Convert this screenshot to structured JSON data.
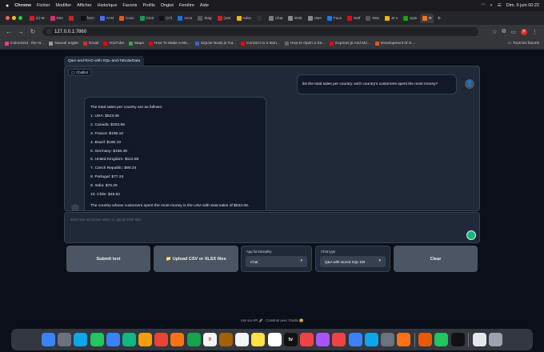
{
  "menubar": {
    "apple": "",
    "app": "Chrome",
    "items": [
      "Fichier",
      "Modifier",
      "Afficher",
      "Historique",
      "Favoris",
      "Profils",
      "Onglet",
      "Fenêtre",
      "Aide"
    ],
    "datetime": "Dim. 9 juin  00:22"
  },
  "tabs": [
    {
      "label": "(1) M",
      "color": "#cc2222"
    },
    {
      "label": "Dire",
      "color": "#d6336c"
    },
    {
      "label": "",
      "color": "#cc2222"
    },
    {
      "label": "form",
      "color": "#111111"
    },
    {
      "label": "AI M",
      "color": "#4a6cf7"
    },
    {
      "label": "Conv",
      "color": "#e8590c"
    },
    {
      "label": "2110",
      "color": "#0f9d58"
    },
    {
      "label": "(17)",
      "color": "#111111"
    },
    {
      "label": "Acce",
      "color": "#1a73e8"
    },
    {
      "label": "Stag",
      "color": "#555555"
    },
    {
      "label": "(104",
      "color": "#cc2222"
    },
    {
      "label": "Adva",
      "color": "#f4b400"
    },
    {
      "label": "",
      "color": "#333333"
    },
    {
      "label": "Chat",
      "color": "#7b7b7b"
    },
    {
      "label": "Emb",
      "color": "#888888"
    },
    {
      "label": "User",
      "color": "#888888"
    },
    {
      "label": "Face",
      "color": "#1877f2"
    },
    {
      "label": "Netf",
      "color": "#e50914"
    },
    {
      "label": "Mas",
      "color": "#555555"
    },
    {
      "label": "Je s",
      "color": "#f4b400"
    },
    {
      "label": "Upw",
      "color": "#14a800"
    },
    {
      "label": "R",
      "color": "#f97316",
      "active": true
    }
  ],
  "toolbar": {
    "url": "127.0.0.1:7860",
    "back_icon": "←",
    "forward_icon": "→",
    "reload_icon": "↻",
    "profile_initial": "P"
  },
  "bookmarks": [
    {
      "label": "Colormind - the AI...",
      "color": "#e83e8c"
    },
    {
      "label": "Nouvel onglet",
      "color": "#9e9e9e"
    },
    {
      "label": "Gmail",
      "color": "#d93025"
    },
    {
      "label": "YouTube",
      "color": "#ff0000"
    },
    {
      "label": "Maps",
      "color": "#34a853"
    },
    {
      "label": "How To Make a Me...",
      "color": "#ff0000"
    },
    {
      "label": "SQLite Node.js Tut...",
      "color": "#3367d6"
    },
    {
      "label": "Connect to a Mon...",
      "color": "#ff0000"
    },
    {
      "label": "How to Open a Str...",
      "color": "#666666"
    },
    {
      "label": "Express.js And Mo...",
      "color": "#ff0000"
    },
    {
      "label": "Development of S...",
      "color": "#e8590c"
    }
  ],
  "bookmarks_right": "Tous les favoris",
  "app": {
    "tab_label": "Q&A-and-RAG-with-SQL-and-TabularData",
    "chatbot_label": "Chatbot",
    "user_message": "list the total sales per country. wich country's customers spent the most money?",
    "bot_intro": "The total sales per country are as follows:",
    "bot_list": [
      "1. USA: $523.06",
      "2. Canada: $303.96",
      "3. France: $195.10",
      "4. Brazil: $190.10",
      "5. Germany: $156.48",
      "6. United Kingdom: $112.86",
      "7. Czech Republic: $90.24",
      "8. Portugal: $77.24",
      "9. India: $75.26",
      "10. Chile: $46.62"
    ],
    "bot_conclusion": "The country whose customers spent the most money is the USA with total sales of $523.06.",
    "input_placeholder": "Enter text and press enter, or upload PDF files",
    "submit_label": "Submit text",
    "upload_label": "📁 Upload CSV or XLSX files",
    "functionality": {
      "label": "App functionality",
      "value": "Chat"
    },
    "chat_type": {
      "label": "Chat type",
      "value": "Q&A with stored SQL-DB"
    },
    "clear_label": "Clear",
    "footer": "Use via API 🚀 · Construit avec Gradio 😊"
  },
  "dock": [
    {
      "name": "finder",
      "color": "#3b82f6"
    },
    {
      "name": "launchpad",
      "color": "#6b7280"
    },
    {
      "name": "safari",
      "color": "#0ea5e9"
    },
    {
      "name": "messages",
      "color": "#22c55e"
    },
    {
      "name": "mail",
      "color": "#3b82f6"
    },
    {
      "name": "maps",
      "color": "#10b981"
    },
    {
      "name": "photos",
      "color": "#f59e0b"
    },
    {
      "name": "chrome",
      "color": "#ea4335"
    },
    {
      "name": "firefox",
      "color": "#f97316"
    },
    {
      "name": "facetime",
      "color": "#16a34a"
    },
    {
      "name": "calendar",
      "color": "#f3f4f6",
      "text": "9"
    },
    {
      "name": "contacts",
      "color": "#a16207"
    },
    {
      "name": "reminders",
      "color": "#f3f4f6"
    },
    {
      "name": "notes",
      "color": "#fde047"
    },
    {
      "name": "freeform",
      "color": "#ffffff"
    },
    {
      "name": "appletv",
      "color": "#111111",
      "text": "tv"
    },
    {
      "name": "music",
      "color": "#ef4444"
    },
    {
      "name": "podcasts",
      "color": "#a855f7"
    },
    {
      "name": "news",
      "color": "#ef4444"
    },
    {
      "name": "appstore",
      "color": "#3b82f6"
    },
    {
      "name": "vscode",
      "color": "#0ea5e9"
    },
    {
      "name": "system-settings",
      "color": "#6b7280"
    },
    {
      "name": "sublime",
      "color": "#f97316"
    },
    {
      "sep": true
    },
    {
      "name": "firefox-dev",
      "color": "#ea580c"
    },
    {
      "name": "spotify",
      "color": "#22c55e"
    },
    {
      "name": "chatgpt",
      "color": "#111111"
    },
    {
      "sep": true
    },
    {
      "name": "chatgpt-app",
      "color": "#e5e7eb"
    },
    {
      "name": "trash",
      "color": "#9ca3af"
    }
  ]
}
